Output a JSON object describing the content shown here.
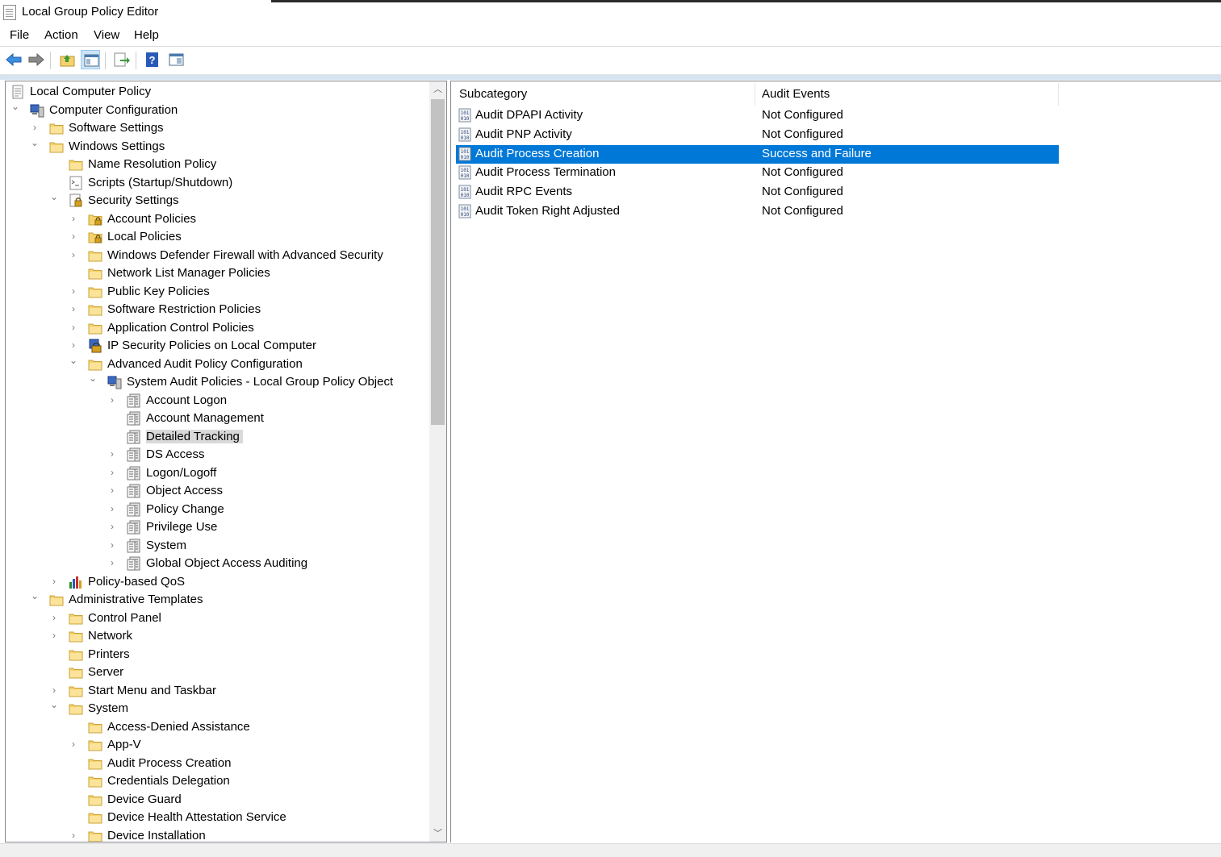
{
  "window": {
    "title": "Local Group Policy Editor"
  },
  "menu": [
    "File",
    "Action",
    "View",
    "Help"
  ],
  "toolbar": [
    "back-icon",
    "forward-icon",
    "up-folder-icon",
    "show-hide-tree-icon",
    "export-list-icon",
    "help-icon",
    "properties-icon"
  ],
  "tree": [
    {
      "label": "Local Computer Policy",
      "icon": "policy-doc",
      "expand": ""
    },
    {
      "label": "Computer Configuration",
      "icon": "computer",
      "expand": "expanded"
    },
    {
      "label": "Software Settings",
      "icon": "folder",
      "expand": "collapsed"
    },
    {
      "label": "Windows Settings",
      "icon": "folder",
      "expand": "expanded"
    },
    {
      "label": "Name Resolution Policy",
      "icon": "folder",
      "expand": ""
    },
    {
      "label": "Scripts (Startup/Shutdown)",
      "icon": "script",
      "expand": ""
    },
    {
      "label": "Security Settings",
      "icon": "security",
      "expand": "expanded"
    },
    {
      "label": "Account Policies",
      "icon": "lock-folder",
      "expand": "collapsed"
    },
    {
      "label": "Local Policies",
      "icon": "lock-folder",
      "expand": "collapsed"
    },
    {
      "label": "Windows Defender Firewall with Advanced Security",
      "icon": "folder",
      "expand": "collapsed"
    },
    {
      "label": "Network List Manager Policies",
      "icon": "folder",
      "expand": ""
    },
    {
      "label": "Public Key Policies",
      "icon": "folder",
      "expand": "collapsed"
    },
    {
      "label": "Software Restriction Policies",
      "icon": "folder",
      "expand": "collapsed"
    },
    {
      "label": "Application Control Policies",
      "icon": "folder",
      "expand": "collapsed"
    },
    {
      "label": "IP Security Policies on Local Computer",
      "icon": "ipsec",
      "expand": "collapsed"
    },
    {
      "label": "Advanced Audit Policy Configuration",
      "icon": "folder",
      "expand": "expanded"
    },
    {
      "label": "System Audit Policies - Local Group Policy Object",
      "icon": "computer",
      "expand": "expanded"
    },
    {
      "label": "Account Logon",
      "icon": "audit",
      "expand": "collapsed"
    },
    {
      "label": "Account Management",
      "icon": "audit",
      "expand": ""
    },
    {
      "label": "Detailed Tracking",
      "icon": "audit",
      "expand": "",
      "selected": true
    },
    {
      "label": "DS Access",
      "icon": "audit",
      "expand": "collapsed"
    },
    {
      "label": "Logon/Logoff",
      "icon": "audit",
      "expand": "collapsed"
    },
    {
      "label": "Object Access",
      "icon": "audit",
      "expand": "collapsed"
    },
    {
      "label": "Policy Change",
      "icon": "audit",
      "expand": "collapsed"
    },
    {
      "label": "Privilege Use",
      "icon": "audit",
      "expand": "collapsed"
    },
    {
      "label": "System",
      "icon": "audit",
      "expand": "collapsed"
    },
    {
      "label": "Global Object Access Auditing",
      "icon": "audit",
      "expand": "collapsed"
    },
    {
      "label": "Policy-based QoS",
      "icon": "qos",
      "expand": "collapsed"
    },
    {
      "label": "Administrative Templates",
      "icon": "folder",
      "expand": "expanded"
    },
    {
      "label": "Control Panel",
      "icon": "folder",
      "expand": "collapsed"
    },
    {
      "label": "Network",
      "icon": "folder",
      "expand": "collapsed"
    },
    {
      "label": "Printers",
      "icon": "folder",
      "expand": ""
    },
    {
      "label": "Server",
      "icon": "folder",
      "expand": ""
    },
    {
      "label": "Start Menu and Taskbar",
      "icon": "folder",
      "expand": "collapsed"
    },
    {
      "label": "System",
      "icon": "folder",
      "expand": "expanded"
    },
    {
      "label": "Access-Denied Assistance",
      "icon": "folder",
      "expand": ""
    },
    {
      "label": "App-V",
      "icon": "folder",
      "expand": "collapsed"
    },
    {
      "label": "Audit Process Creation",
      "icon": "folder",
      "expand": ""
    },
    {
      "label": "Credentials Delegation",
      "icon": "folder",
      "expand": ""
    },
    {
      "label": "Device Guard",
      "icon": "folder",
      "expand": ""
    },
    {
      "label": "Device Health Attestation Service",
      "icon": "folder",
      "expand": ""
    },
    {
      "label": "Device Installation",
      "icon": "folder",
      "expand": "collapsed"
    }
  ],
  "list": {
    "columns": [
      "Subcategory",
      "Audit Events"
    ],
    "rows": [
      {
        "subcategory": "Audit DPAPI Activity",
        "events": "Not Configured"
      },
      {
        "subcategory": "Audit PNP Activity",
        "events": "Not Configured"
      },
      {
        "subcategory": "Audit Process Creation",
        "events": "Success and Failure",
        "selected": true
      },
      {
        "subcategory": "Audit Process Termination",
        "events": "Not Configured"
      },
      {
        "subcategory": "Audit RPC Events",
        "events": "Not Configured"
      },
      {
        "subcategory": "Audit Token Right Adjusted",
        "events": "Not Configured"
      }
    ]
  },
  "colors": {
    "selection": "#0078d7",
    "folder": "#f5d26b",
    "tree_selected": "#d9d9d9"
  }
}
